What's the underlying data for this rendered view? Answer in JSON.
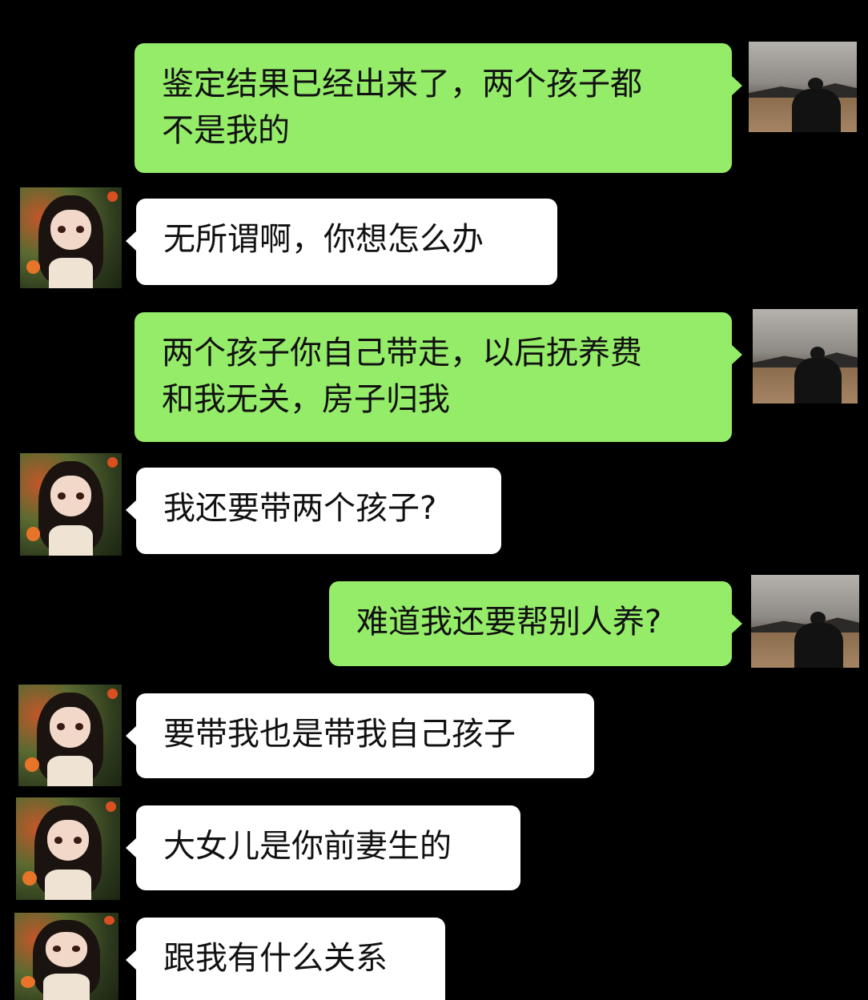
{
  "messages": [
    {
      "sender": "me",
      "text_lines": [
        "鉴定结果已经出来了，两个孩子都",
        "不是我的"
      ]
    },
    {
      "sender": "them",
      "text_lines": [
        "无所谓啊，你想怎么办"
      ]
    },
    {
      "sender": "me",
      "text_lines": [
        "两个孩子你自己带走，以后抚养费",
        "和我无关，房子归我"
      ]
    },
    {
      "sender": "them",
      "text_lines": [
        "我还要带两个孩子?"
      ]
    },
    {
      "sender": "me",
      "text_lines": [
        "难道我还要帮别人养?"
      ]
    },
    {
      "sender": "them",
      "text_lines": [
        "要带我也是带我自己孩子"
      ]
    },
    {
      "sender": "them",
      "text_lines": [
        "大女儿是你前妻生的"
      ]
    },
    {
      "sender": "them",
      "text_lines": [
        "跟我有什么关系"
      ]
    }
  ],
  "avatars": {
    "me": "man-silhouette-avatar",
    "them": "anime-girl-avatar"
  },
  "colors": {
    "background": "#000000",
    "me_bubble": "#95ec69",
    "them_bubble": "#ffffff",
    "text": "#111111"
  }
}
